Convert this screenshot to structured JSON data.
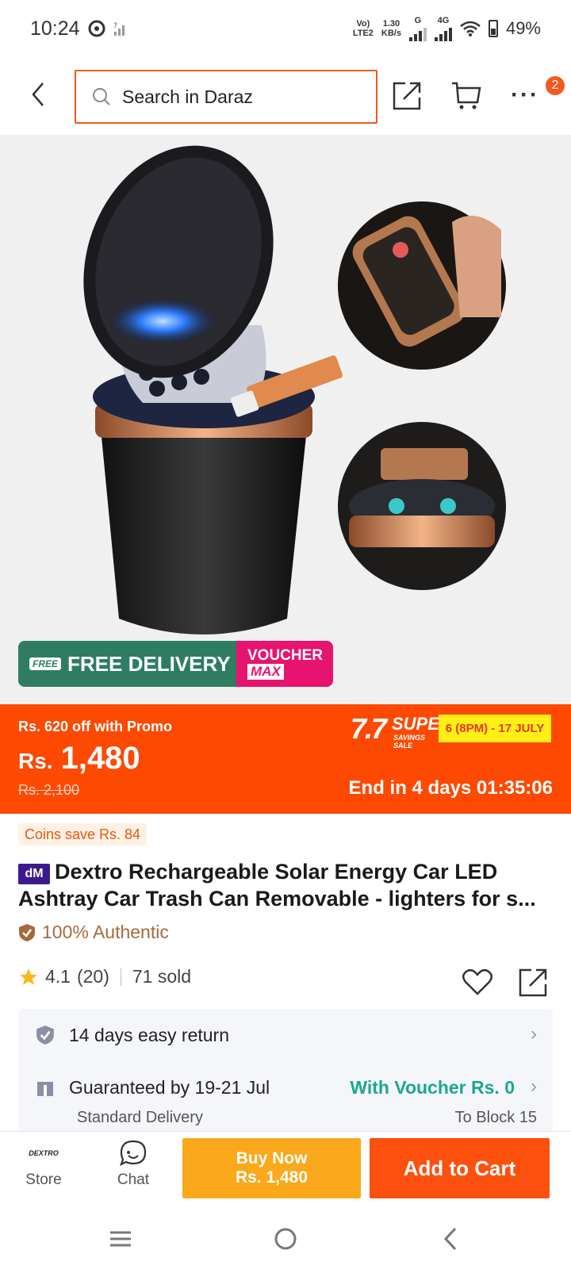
{
  "status_bar": {
    "time": "10:24",
    "net_label_top": "Vo)",
    "net_label_bottom": "LTE2",
    "speed_top": "1.30",
    "speed_bottom": "KB/s",
    "g_label": "G",
    "lte_label": "4G",
    "battery": "49%"
  },
  "header": {
    "search_placeholder": "Search in Daraz",
    "cart_badge": "2",
    "more_label": "···"
  },
  "hero": {
    "free_tag": "FREE",
    "free_delivery": "FREE DELIVERY",
    "voucher_line1": "VOUCHER",
    "voucher_line2": "MAX"
  },
  "price_banner": {
    "promo_text": "Rs. 620 off with Promo",
    "currency": "Rs.",
    "price": "1,480",
    "old_price": "Rs. 2,100",
    "sale_number": "7.7",
    "sale_super": "SUPER",
    "sale_sub": "SAVINGS SALE",
    "sale_dates": "6 (8PM) - 17 JULY",
    "countdown": "End in 4 days 01:35:06"
  },
  "product": {
    "coins": "Coins save Rs. 84",
    "brand_badge": "dM",
    "title": "Dextro Rechargeable Solar Energy Car LED Ashtray Car Trash Can Removable - lighters for s...",
    "authentic": "100% Authentic",
    "rating": "4.1",
    "rating_count": "(20)",
    "sold": "71 sold"
  },
  "services": {
    "return": "14 days easy return",
    "guarantee": "Guaranteed by 19-21 Jul",
    "voucher": "With Voucher Rs. 0",
    "delivery_type": "Standard Delivery",
    "location": "To Block 15"
  },
  "bottom_bar": {
    "store_logo": "DEXTRO",
    "store_label": "Store",
    "chat_label": "Chat",
    "buy_now_line1": "Buy Now",
    "buy_now_line2": "Rs. 1,480",
    "add_to_cart": "Add to Cart"
  },
  "colors": {
    "accent": "#fd4901",
    "search_border": "#f0591e",
    "buy_now": "#fba81a",
    "add_to_cart": "#fd4f0d",
    "free_delivery": "#2e7d62",
    "voucher": "#e8136f",
    "voucher_text": "#1aa88f"
  }
}
